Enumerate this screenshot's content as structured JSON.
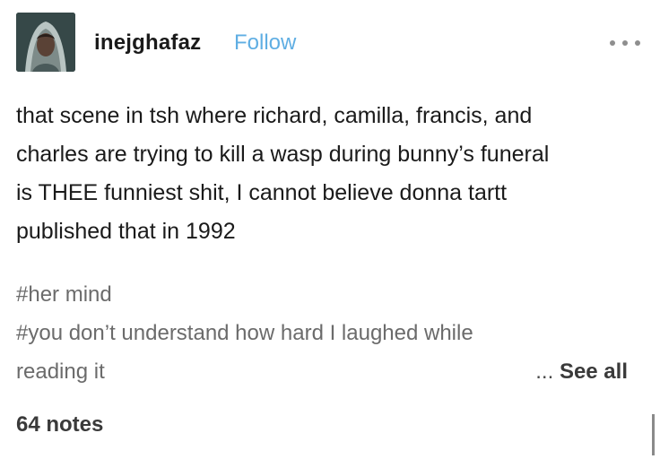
{
  "post": {
    "author": {
      "username": "inejghafaz",
      "follow_label": "Follow",
      "avatar_icon": "avatar-hooded-figure"
    },
    "more_icon": "ellipsis-icon",
    "body_lines": [
      "that scene in tsh where richard, camilla, francis, and",
      "charles are trying to kill a wasp during bunny’s funeral",
      "is THEE funniest shit, I cannot believe donna tartt",
      "published that in 1992"
    ],
    "tags": [
      "#her mind",
      "#you don’t understand how hard I laughed while",
      "reading it"
    ],
    "see_all_prefix": "...",
    "see_all_label": "See all",
    "notes": "64 notes"
  },
  "colors": {
    "follow": "#5faee3",
    "tag_text": "#6b6b6b",
    "body_text": "#1a1a1a"
  }
}
